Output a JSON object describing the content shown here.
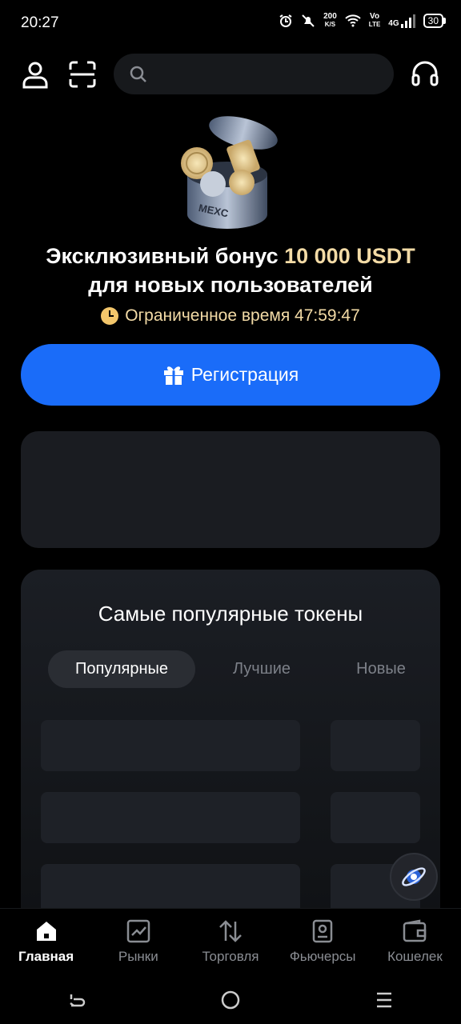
{
  "status_bar": {
    "time": "20:27",
    "net_speed_top": "200",
    "net_speed_bottom": "K/S",
    "volte_top": "Vo",
    "volte_bottom": "LTE",
    "network": "4G",
    "battery": "30"
  },
  "header": {
    "search_placeholder": ""
  },
  "promo": {
    "title_prefix": "Эксклюзивный бонус ",
    "title_accent": "10 000 USDT",
    "title_line2": "для новых пользователей",
    "timer_label": "Ограниченное время ",
    "timer_value": "47:59:47",
    "register_label": "Регистрация",
    "image_brand_text": "MEXC"
  },
  "tokens": {
    "title": "Самые популярные токены",
    "tabs": [
      "Популярные",
      "Лучшие",
      "Новые"
    ],
    "active_tab": 0
  },
  "bottom_nav": {
    "items": [
      "Главная",
      "Рынки",
      "Торговля",
      "Фьючерсы",
      "Кошелек"
    ],
    "active": 0
  },
  "colors": {
    "accent_blue": "#1a6cf9",
    "accent_gold": "#f3dba6",
    "background": "#000000",
    "card": "#1a1c21"
  }
}
